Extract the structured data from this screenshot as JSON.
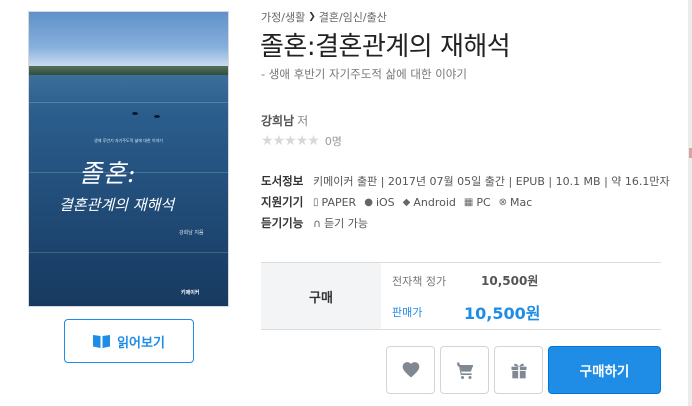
{
  "cover": {
    "small_text": "생애 후반기 자기주도적 삶에 대한 이야기",
    "title_line1": "졸혼:",
    "title_line2": "결혼관계의 재해석",
    "author": "강희남 지음",
    "publisher": "키메이커"
  },
  "preview_button": {
    "label": "읽어보기",
    "icon": "book-open-icon"
  },
  "breadcrumb": {
    "items": [
      "가정/생활",
      "결혼/임신/출산"
    ],
    "separator": "❯"
  },
  "book": {
    "title": "졸혼:결혼관계의 재해석",
    "subtitle": "- 생애 후반기 자기주도적 삶에 대한 이야기",
    "author": "강희남",
    "author_role": "저",
    "rating_stars": 0,
    "rating_max": 5,
    "rating_count": "0명"
  },
  "info": {
    "book_info_label": "도서정보",
    "book_info_value": "키메이커 출판 | 2017년 07월 05일 출간 | EPUB | 10.1 MB | 약 16.1만자",
    "devices_label": "지원기기",
    "devices": [
      {
        "icon": "phone-icon",
        "label": "PAPER"
      },
      {
        "icon": "apple-icon",
        "label": "iOS"
      },
      {
        "icon": "android-icon",
        "label": "Android"
      },
      {
        "icon": "windows-icon",
        "label": "PC"
      },
      {
        "icon": "mac-icon",
        "label": "Mac"
      }
    ],
    "listen_label": "듣기기능",
    "listen_value": "듣기 가능"
  },
  "purchase": {
    "section_label": "구매",
    "list_price_label": "전자책 정가",
    "list_price": "10,500원",
    "sale_price_label": "판매가",
    "sale_price": "10,500원"
  },
  "actions": {
    "wishlist_icon": "heart-icon",
    "cart_icon": "cart-icon",
    "gift_icon": "gift-icon",
    "buy_label": "구매하기"
  },
  "colors": {
    "accent": "#1f8ce6",
    "star_empty": "#d8d8d8",
    "price_box_bg": "#f3f4f5"
  }
}
